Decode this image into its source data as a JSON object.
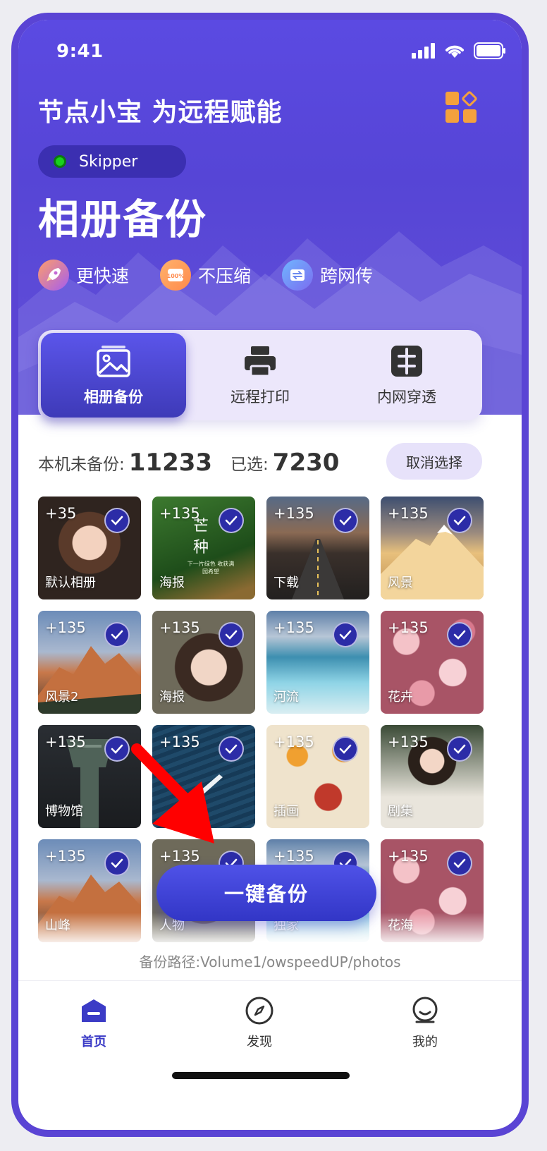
{
  "status": {
    "time": "9:41"
  },
  "header": {
    "headline": "节点小宝 为远程赋能",
    "device_name": "Skipper",
    "title": "相册备份"
  },
  "features": [
    {
      "label": "更快速",
      "icon": "rocket-icon"
    },
    {
      "label": "不压缩",
      "icon": "hundred-percent-icon"
    },
    {
      "label": "跨网传",
      "icon": "transfer-icon"
    }
  ],
  "tabs": [
    {
      "label": "相册备份"
    },
    {
      "label": "远程打印"
    },
    {
      "label": "内网穿透"
    }
  ],
  "stats": {
    "unbacked_label": "本机未备份:",
    "unbacked_value": "11233",
    "selected_label": "已选:",
    "selected_value": "7230",
    "cancel_label": "取消选择"
  },
  "albums": [
    {
      "count": "+35",
      "name": "默认相册"
    },
    {
      "count": "+135",
      "name": "海报"
    },
    {
      "count": "+135",
      "name": "下载"
    },
    {
      "count": "+135",
      "name": "风景"
    },
    {
      "count": "+135",
      "name": "风景2"
    },
    {
      "count": "+135",
      "name": "海报"
    },
    {
      "count": "+135",
      "name": "河流"
    },
    {
      "count": "+135",
      "name": "花卉"
    },
    {
      "count": "+135",
      "name": "博物馆"
    },
    {
      "count": "+135",
      "name": ""
    },
    {
      "count": "+135",
      "name": "插画"
    },
    {
      "count": "+135",
      "name": "剧集"
    },
    {
      "count": "+135",
      "name": "山峰"
    },
    {
      "count": "+135",
      "name": "人物"
    },
    {
      "count": "+135",
      "name": "独家"
    },
    {
      "count": "+135",
      "name": "花海"
    }
  ],
  "poster_text": {
    "big": "芒种",
    "small": "下一片绿色 收获满园希望"
  },
  "backup_button": "一键备份",
  "backup_path": "备份路径:Volume1/owspeedUP/photos",
  "bottom_nav": [
    {
      "label": "首页",
      "icon": "home-icon"
    },
    {
      "label": "发现",
      "icon": "compass-icon"
    },
    {
      "label": "我的",
      "icon": "profile-icon"
    }
  ],
  "colors": {
    "primary": "#5645d6",
    "accent_button": "#3a3cc8",
    "check": "#2c2ca7",
    "device_dot": "#19d11f"
  }
}
